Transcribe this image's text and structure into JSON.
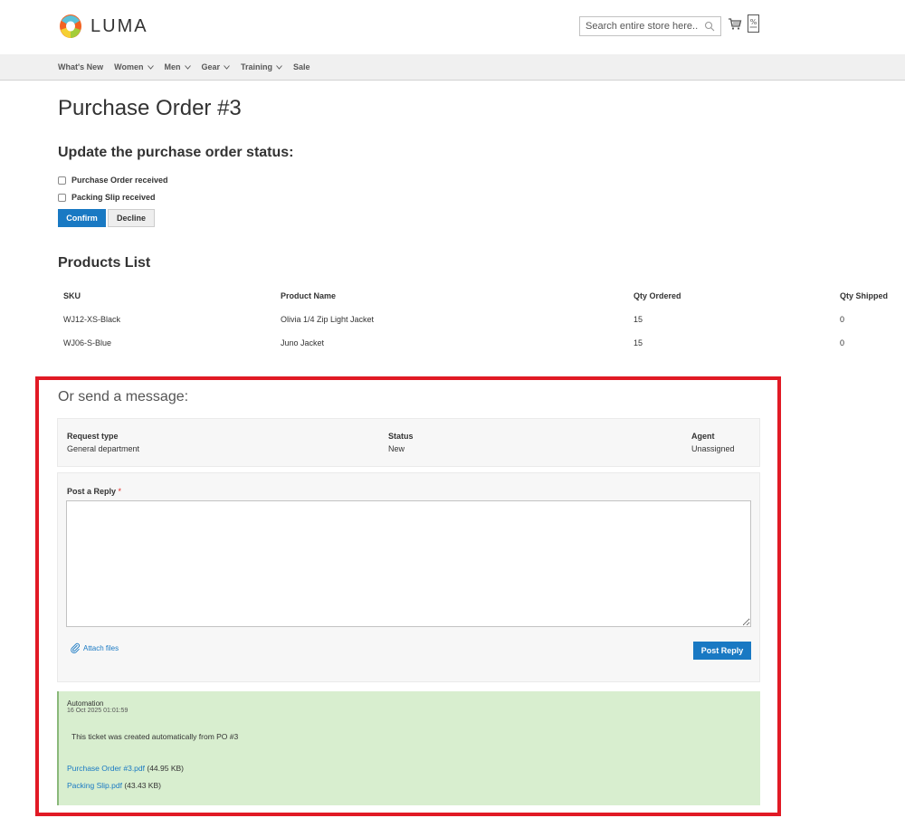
{
  "header": {
    "logo_text": "LUMA",
    "search_placeholder": "Search entire store here..."
  },
  "nav": {
    "items": [
      "What's New",
      "Women",
      "Men",
      "Gear",
      "Training",
      "Sale"
    ]
  },
  "page": {
    "title": "Purchase Order #3",
    "status_heading": "Update the purchase order status:",
    "checkbox_po": "Purchase Order received",
    "checkbox_slip": "Packing Slip received",
    "confirm_label": "Confirm",
    "decline_label": "Decline"
  },
  "products": {
    "heading": "Products List",
    "columns": [
      "SKU",
      "Product Name",
      "Qty Ordered",
      "Qty Shipped"
    ],
    "rows": [
      [
        "WJ12-XS-Black",
        "Olivia 1/4 Zip Light Jacket",
        "15",
        "0"
      ],
      [
        "WJ06-S-Blue",
        "Juno Jacket",
        "15",
        "0"
      ]
    ]
  },
  "message": {
    "heading": "Or send a message:",
    "request_type_label": "Request type",
    "request_type_value": "General department",
    "status_label": "Status",
    "status_value": "New",
    "agent_label": "Agent",
    "agent_value": "Unassigned",
    "reply_label": "Post a Reply",
    "required_mark": "*",
    "reply_value": "",
    "attach_label": "Attach files",
    "post_label": "Post Reply"
  },
  "automation": {
    "author": "Automation",
    "date": "16 Oct 2025 01:01:59",
    "body": "This ticket was created automatically from PO #3",
    "files": [
      {
        "name": "Purchase Order #3.pdf",
        "size": "(44.95 KB)"
      },
      {
        "name": "Packing Slip.pdf",
        "size": "(43.43 KB)"
      }
    ]
  },
  "colors": {
    "accent": "#1979c3",
    "highlight_frame": "#e11a25",
    "message_bg": "#d8eecf"
  }
}
